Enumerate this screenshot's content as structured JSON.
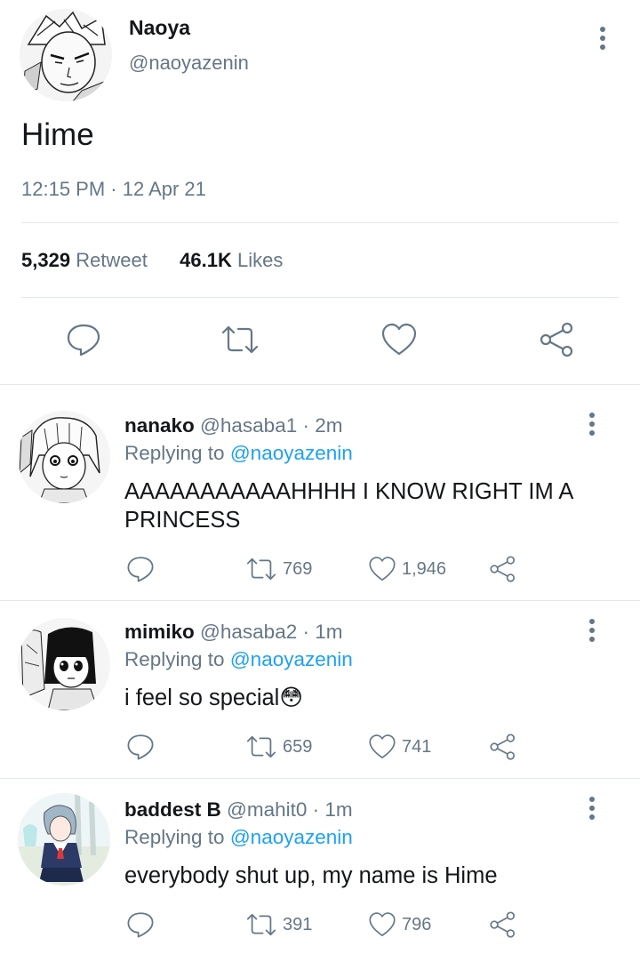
{
  "tweet": {
    "author_name": "Naoya",
    "author_handle": "@naoyazenin",
    "text": "Hime",
    "timestamp": "12:15 PM · 12 Apr 21",
    "retweet_count": "5,329",
    "retweet_label": "Retweet",
    "like_count": "46.1K",
    "like_label": "Likes"
  },
  "replies": [
    {
      "name": "nanako",
      "handle": "@hasaba1",
      "time": "· 2m",
      "replying_prefix": "Replying to",
      "replying_to": "@naoyazenin",
      "text": "AAAAAAAAAAAHHHH I KNOW RIGHT IM A PRINCESS",
      "retweets": "769",
      "likes": "1,946"
    },
    {
      "name": "mimiko",
      "handle": "@hasaba2",
      "time": "· 1m",
      "replying_prefix": "Replying to",
      "replying_to": "@naoyazenin",
      "text": "i feel so special",
      "emoji": "😳",
      "retweets": "659",
      "likes": "741"
    },
    {
      "name": "baddest B",
      "handle": "@mahit0",
      "time": "· 1m",
      "replying_prefix": "Replying to",
      "replying_to": "@naoyazenin",
      "text": "everybody shut up, my name is Hime",
      "retweets": "391",
      "likes": "796"
    }
  ],
  "icons": {
    "reply": "reply-icon",
    "retweet": "retweet-icon",
    "like": "heart-icon",
    "share": "share-icon",
    "more": "more-vertical-icon"
  },
  "colors": {
    "text": "#14171a",
    "secondary": "#657786",
    "link": "#1da1f2",
    "divider": "#e1e8ed"
  }
}
